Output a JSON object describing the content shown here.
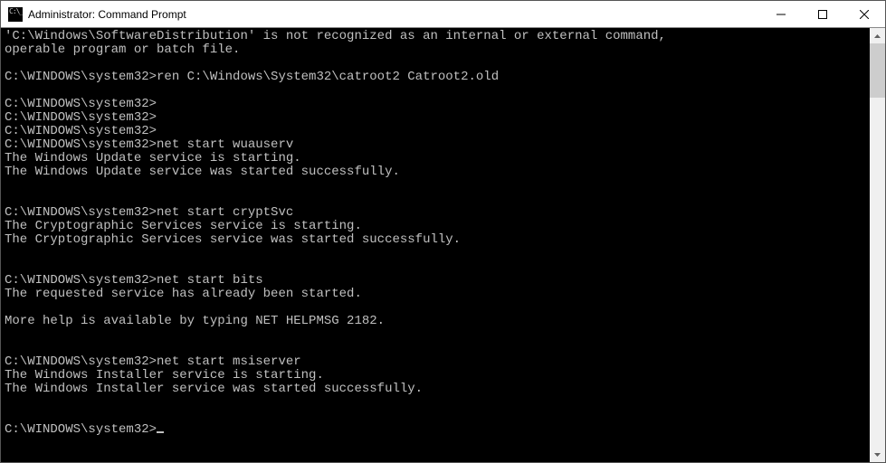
{
  "window": {
    "title": "Administrator: Command Prompt"
  },
  "console": {
    "prompt": "C:\\WINDOWS\\system32>",
    "lines": [
      "'C:\\Windows\\SoftwareDistribution' is not recognized as an internal or external command,",
      "operable program or batch file.",
      "",
      "C:\\WINDOWS\\system32>ren C:\\Windows\\System32\\catroot2 Catroot2.old",
      "",
      "C:\\WINDOWS\\system32>",
      "C:\\WINDOWS\\system32>",
      "C:\\WINDOWS\\system32>",
      "C:\\WINDOWS\\system32>net start wuauserv",
      "The Windows Update service is starting.",
      "The Windows Update service was started successfully.",
      "",
      "",
      "C:\\WINDOWS\\system32>net start cryptSvc",
      "The Cryptographic Services service is starting.",
      "The Cryptographic Services service was started successfully.",
      "",
      "",
      "C:\\WINDOWS\\system32>net start bits",
      "The requested service has already been started.",
      "",
      "More help is available by typing NET HELPMSG 2182.",
      "",
      "",
      "C:\\WINDOWS\\system32>net start msiserver",
      "The Windows Installer service is starting.",
      "The Windows Installer service was started successfully.",
      "",
      "",
      "C:\\WINDOWS\\system32>"
    ]
  }
}
